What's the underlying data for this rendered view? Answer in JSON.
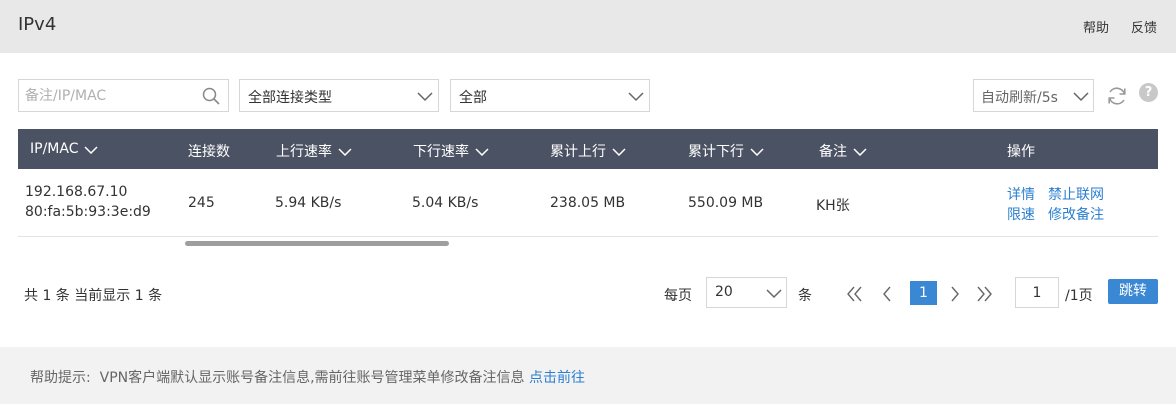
{
  "header": {
    "title": "IPv4",
    "help_label": "帮助",
    "feedback_label": "反馈"
  },
  "filters": {
    "search_placeholder": "备注/IP/MAC",
    "connection_type": "全部连接类型",
    "scope": "全部",
    "auto_refresh": "自动刷新/5s"
  },
  "table": {
    "columns": {
      "ip_mac": "IP/MAC",
      "connections": "连接数",
      "up_rate": "上行速率",
      "down_rate": "下行速率",
      "total_up": "累计上行",
      "total_down": "累计下行",
      "remark": "备注",
      "actions": "操作"
    },
    "rows": [
      {
        "ip": "192.168.67.10",
        "mac": "80:fa:5b:93:3e:d9",
        "connections": "245",
        "up_rate": "5.94 KB/s",
        "down_rate": "5.04 KB/s",
        "total_up": "238.05 MB",
        "total_down": "550.09 MB",
        "remark": "KH张",
        "actions": {
          "details": "详情",
          "block": "禁止联网",
          "limit": "限速",
          "edit_remark": "修改备注"
        }
      }
    ]
  },
  "pagination": {
    "summary": "共 1 条 当前显示 1 条",
    "per_page_label": "每页",
    "page_size": "20",
    "unit": "条",
    "current_page": "1",
    "page_input": "1",
    "total_pages": "/1页",
    "jump_label": "跳转"
  },
  "footer": {
    "hint": "帮助提示:  VPN客户端默认显示账号备注信息,需前往账号管理菜单修改备注信息",
    "link": "点击前往"
  },
  "colors": {
    "table_header": "#4b5263",
    "accent": "#3a87d4",
    "link": "#2b7fd0"
  }
}
